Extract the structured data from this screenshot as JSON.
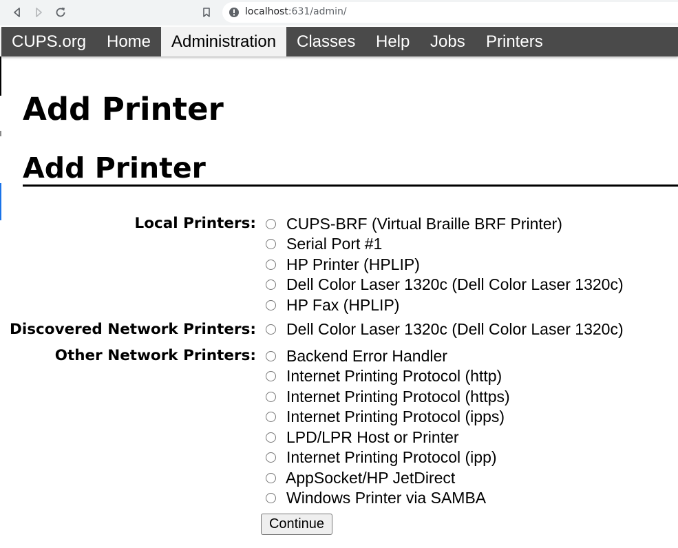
{
  "browser": {
    "url_host": "localhost",
    "url_rest": ":631/admin/"
  },
  "nav": {
    "items": [
      "CUPS.org",
      "Home",
      "Administration",
      "Classes",
      "Help",
      "Jobs",
      "Printers"
    ],
    "active": "Administration"
  },
  "page": {
    "title": "Add Printer",
    "section_title": "Add Printer"
  },
  "form": {
    "groups": [
      {
        "label": "Local Printers:",
        "options": [
          "CUPS-BRF (Virtual Braille BRF Printer)",
          "Serial Port #1",
          "HP Printer (HPLIP)",
          "Dell Color Laser 1320c (Dell Color Laser 1320c)",
          "HP Fax (HPLIP)"
        ]
      },
      {
        "label": "Discovered Network Printers:",
        "options": [
          "Dell Color Laser 1320c (Dell Color Laser 1320c)"
        ]
      },
      {
        "label": "Other Network Printers:",
        "options": [
          "Backend Error Handler",
          "Internet Printing Protocol (http)",
          "Internet Printing Protocol (https)",
          "Internet Printing Protocol (ipps)",
          "LPD/LPR Host or Printer",
          "Internet Printing Protocol (ipp)",
          "AppSocket/HP JetDirect",
          "Windows Printer via SAMBA"
        ]
      }
    ],
    "continue_label": "Continue"
  }
}
